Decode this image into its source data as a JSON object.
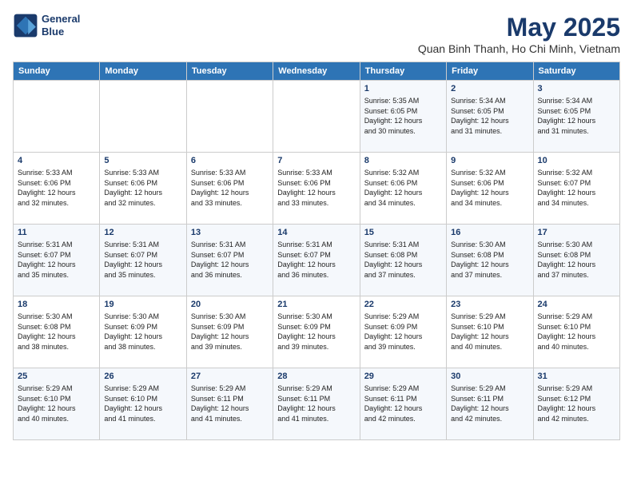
{
  "header": {
    "logo_line1": "General",
    "logo_line2": "Blue",
    "title": "May 2025",
    "subtitle": "Quan Binh Thanh, Ho Chi Minh, Vietnam"
  },
  "days_of_week": [
    "Sunday",
    "Monday",
    "Tuesday",
    "Wednesday",
    "Thursday",
    "Friday",
    "Saturday"
  ],
  "weeks": [
    [
      {
        "day": "",
        "info": ""
      },
      {
        "day": "",
        "info": ""
      },
      {
        "day": "",
        "info": ""
      },
      {
        "day": "",
        "info": ""
      },
      {
        "day": "1",
        "info": "Sunrise: 5:35 AM\nSunset: 6:05 PM\nDaylight: 12 hours\nand 30 minutes."
      },
      {
        "day": "2",
        "info": "Sunrise: 5:34 AM\nSunset: 6:05 PM\nDaylight: 12 hours\nand 31 minutes."
      },
      {
        "day": "3",
        "info": "Sunrise: 5:34 AM\nSunset: 6:05 PM\nDaylight: 12 hours\nand 31 minutes."
      }
    ],
    [
      {
        "day": "4",
        "info": "Sunrise: 5:33 AM\nSunset: 6:06 PM\nDaylight: 12 hours\nand 32 minutes."
      },
      {
        "day": "5",
        "info": "Sunrise: 5:33 AM\nSunset: 6:06 PM\nDaylight: 12 hours\nand 32 minutes."
      },
      {
        "day": "6",
        "info": "Sunrise: 5:33 AM\nSunset: 6:06 PM\nDaylight: 12 hours\nand 33 minutes."
      },
      {
        "day": "7",
        "info": "Sunrise: 5:33 AM\nSunset: 6:06 PM\nDaylight: 12 hours\nand 33 minutes."
      },
      {
        "day": "8",
        "info": "Sunrise: 5:32 AM\nSunset: 6:06 PM\nDaylight: 12 hours\nand 34 minutes."
      },
      {
        "day": "9",
        "info": "Sunrise: 5:32 AM\nSunset: 6:06 PM\nDaylight: 12 hours\nand 34 minutes."
      },
      {
        "day": "10",
        "info": "Sunrise: 5:32 AM\nSunset: 6:07 PM\nDaylight: 12 hours\nand 34 minutes."
      }
    ],
    [
      {
        "day": "11",
        "info": "Sunrise: 5:31 AM\nSunset: 6:07 PM\nDaylight: 12 hours\nand 35 minutes."
      },
      {
        "day": "12",
        "info": "Sunrise: 5:31 AM\nSunset: 6:07 PM\nDaylight: 12 hours\nand 35 minutes."
      },
      {
        "day": "13",
        "info": "Sunrise: 5:31 AM\nSunset: 6:07 PM\nDaylight: 12 hours\nand 36 minutes."
      },
      {
        "day": "14",
        "info": "Sunrise: 5:31 AM\nSunset: 6:07 PM\nDaylight: 12 hours\nand 36 minutes."
      },
      {
        "day": "15",
        "info": "Sunrise: 5:31 AM\nSunset: 6:08 PM\nDaylight: 12 hours\nand 37 minutes."
      },
      {
        "day": "16",
        "info": "Sunrise: 5:30 AM\nSunset: 6:08 PM\nDaylight: 12 hours\nand 37 minutes."
      },
      {
        "day": "17",
        "info": "Sunrise: 5:30 AM\nSunset: 6:08 PM\nDaylight: 12 hours\nand 37 minutes."
      }
    ],
    [
      {
        "day": "18",
        "info": "Sunrise: 5:30 AM\nSunset: 6:08 PM\nDaylight: 12 hours\nand 38 minutes."
      },
      {
        "day": "19",
        "info": "Sunrise: 5:30 AM\nSunset: 6:09 PM\nDaylight: 12 hours\nand 38 minutes."
      },
      {
        "day": "20",
        "info": "Sunrise: 5:30 AM\nSunset: 6:09 PM\nDaylight: 12 hours\nand 39 minutes."
      },
      {
        "day": "21",
        "info": "Sunrise: 5:30 AM\nSunset: 6:09 PM\nDaylight: 12 hours\nand 39 minutes."
      },
      {
        "day": "22",
        "info": "Sunrise: 5:29 AM\nSunset: 6:09 PM\nDaylight: 12 hours\nand 39 minutes."
      },
      {
        "day": "23",
        "info": "Sunrise: 5:29 AM\nSunset: 6:10 PM\nDaylight: 12 hours\nand 40 minutes."
      },
      {
        "day": "24",
        "info": "Sunrise: 5:29 AM\nSunset: 6:10 PM\nDaylight: 12 hours\nand 40 minutes."
      }
    ],
    [
      {
        "day": "25",
        "info": "Sunrise: 5:29 AM\nSunset: 6:10 PM\nDaylight: 12 hours\nand 40 minutes."
      },
      {
        "day": "26",
        "info": "Sunrise: 5:29 AM\nSunset: 6:10 PM\nDaylight: 12 hours\nand 41 minutes."
      },
      {
        "day": "27",
        "info": "Sunrise: 5:29 AM\nSunset: 6:11 PM\nDaylight: 12 hours\nand 41 minutes."
      },
      {
        "day": "28",
        "info": "Sunrise: 5:29 AM\nSunset: 6:11 PM\nDaylight: 12 hours\nand 41 minutes."
      },
      {
        "day": "29",
        "info": "Sunrise: 5:29 AM\nSunset: 6:11 PM\nDaylight: 12 hours\nand 42 minutes."
      },
      {
        "day": "30",
        "info": "Sunrise: 5:29 AM\nSunset: 6:11 PM\nDaylight: 12 hours\nand 42 minutes."
      },
      {
        "day": "31",
        "info": "Sunrise: 5:29 AM\nSunset: 6:12 PM\nDaylight: 12 hours\nand 42 minutes."
      }
    ]
  ]
}
